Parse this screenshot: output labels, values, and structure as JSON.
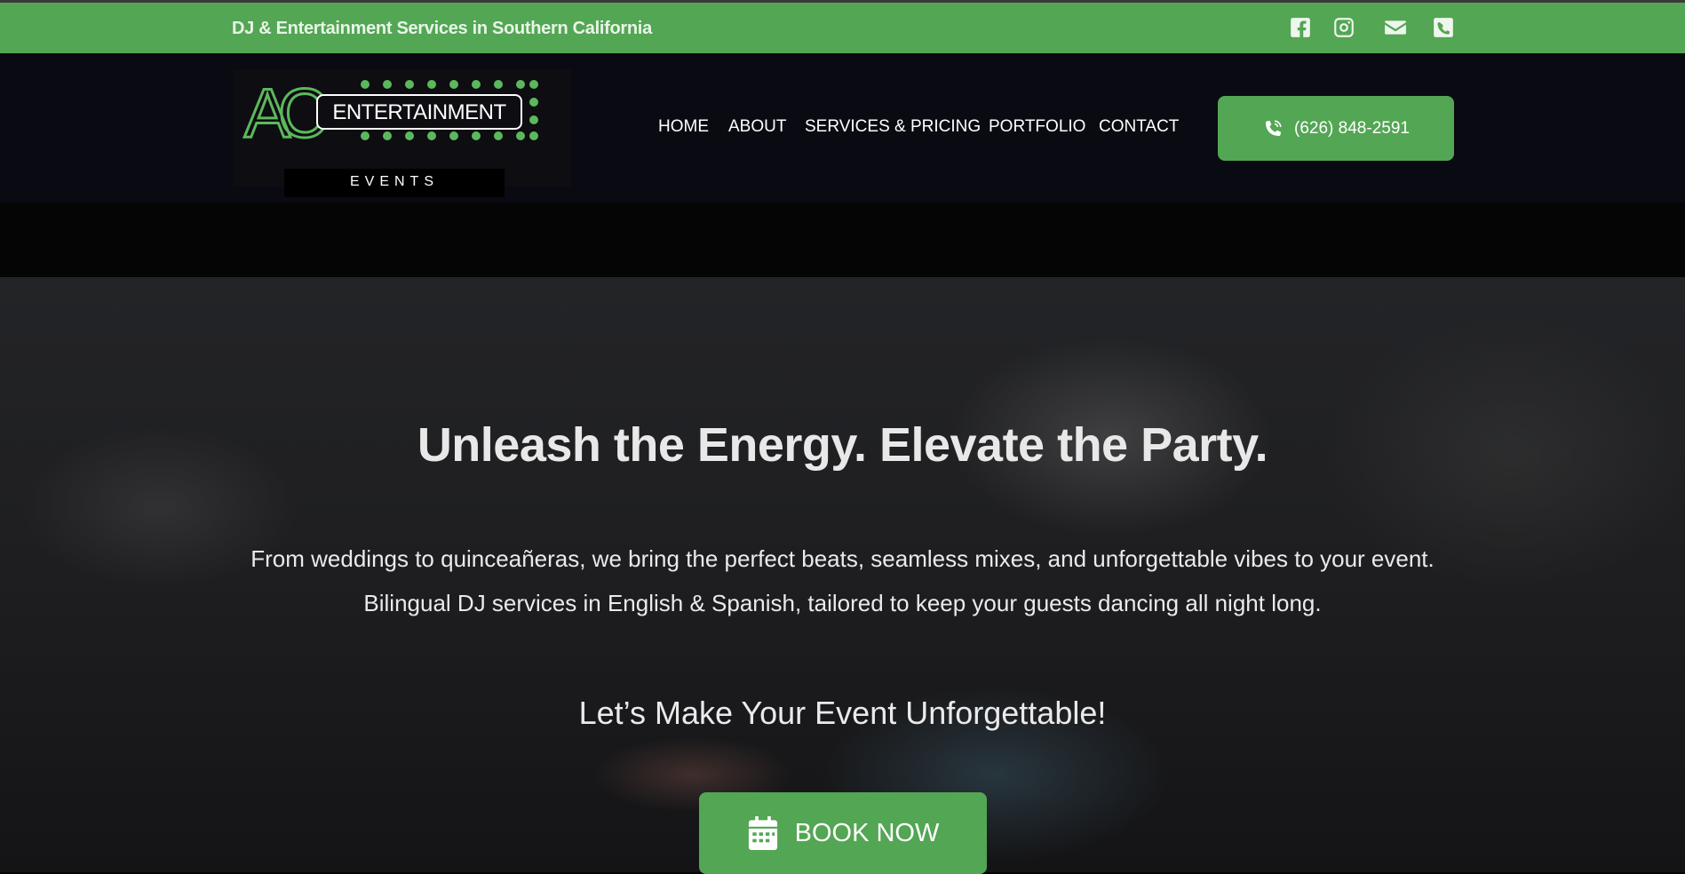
{
  "topbar": {
    "tagline": "DJ & Entertainment Services in Southern California",
    "social_icons": [
      "facebook-icon",
      "instagram-icon",
      "email-icon",
      "phone-square-icon"
    ]
  },
  "logo": {
    "letters": "AC",
    "word": "ENTERTAINMENT",
    "sub": "EVENTS"
  },
  "nav": {
    "items": [
      "HOME",
      "ABOUT",
      "SERVICES & PRICING",
      "PORTFOLIO",
      "CONTACT"
    ]
  },
  "call_button": {
    "icon": "phone-ringing-icon",
    "label": "(626) 848-2591"
  },
  "hero": {
    "title": "Unleash the Energy. Elevate the Party.",
    "description": "From weddings to quinceañeras, we bring the perfect beats, seamless mixes, and unforgettable vibes to your event. Bilingual DJ services in English & Spanish, tailored to keep your guests dancing all night long.",
    "subtitle": "Let’s Make Your Event Unforgettable!",
    "cta": {
      "icon": "calendar-icon",
      "label": "BOOK NOW"
    }
  },
  "colors": {
    "brand_green": "#53a653",
    "header_bg": "#0a0a12",
    "text": "#ffffff"
  }
}
